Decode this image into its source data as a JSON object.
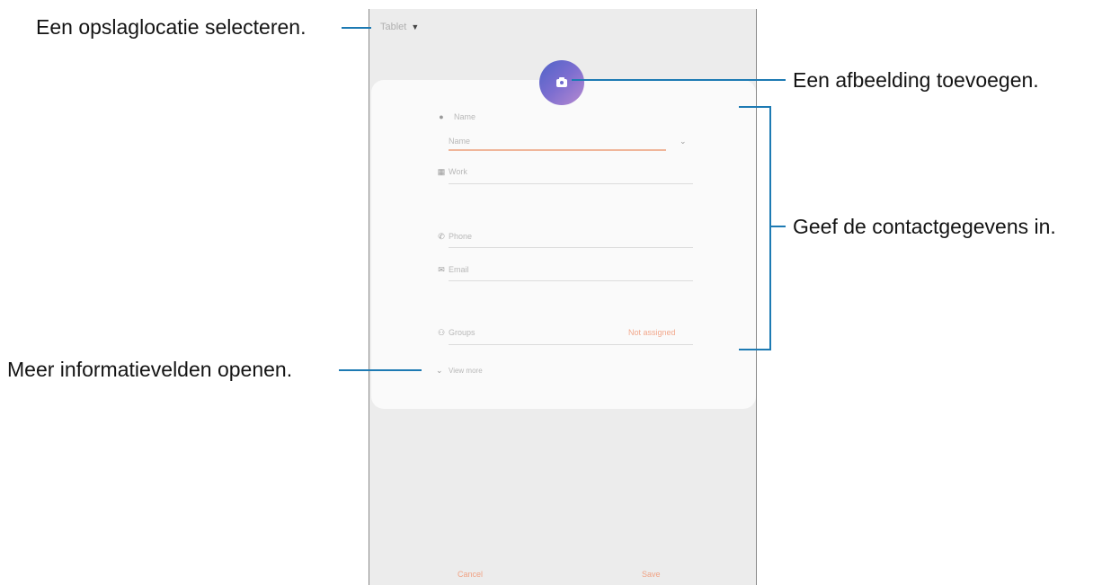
{
  "phone": {
    "storage_location": "Tablet",
    "fields": {
      "name_label": "Name",
      "name_placeholder": "Name",
      "work_label": "Work",
      "phone_label": "Phone",
      "email_label": "Email",
      "groups_label": "Groups",
      "groups_value": "Not assigned",
      "view_more": "View more"
    },
    "buttons": {
      "cancel": "Cancel",
      "save": "Save"
    }
  },
  "callouts": {
    "storage": "Een opslaglocatie selecteren.",
    "image": "Een afbeelding toevoegen.",
    "contact": "Geef de contactgegevens in.",
    "more": "Meer informatievelden openen."
  },
  "colors": {
    "callout_line": "#1d7ab3",
    "accent_orange": "#f0a385",
    "avatar_gradient_start": "#4f63c8",
    "avatar_gradient_end": "#b78ad0"
  },
  "icons": {
    "storage_dropdown": "caret-down-icon",
    "avatar": "camera-icon",
    "name": "person-icon",
    "name_expand": "chevron-down-icon",
    "work": "building-icon",
    "phone": "phone-icon",
    "email": "envelope-icon",
    "groups": "people-icon",
    "view_more": "chevron-down-icon"
  }
}
